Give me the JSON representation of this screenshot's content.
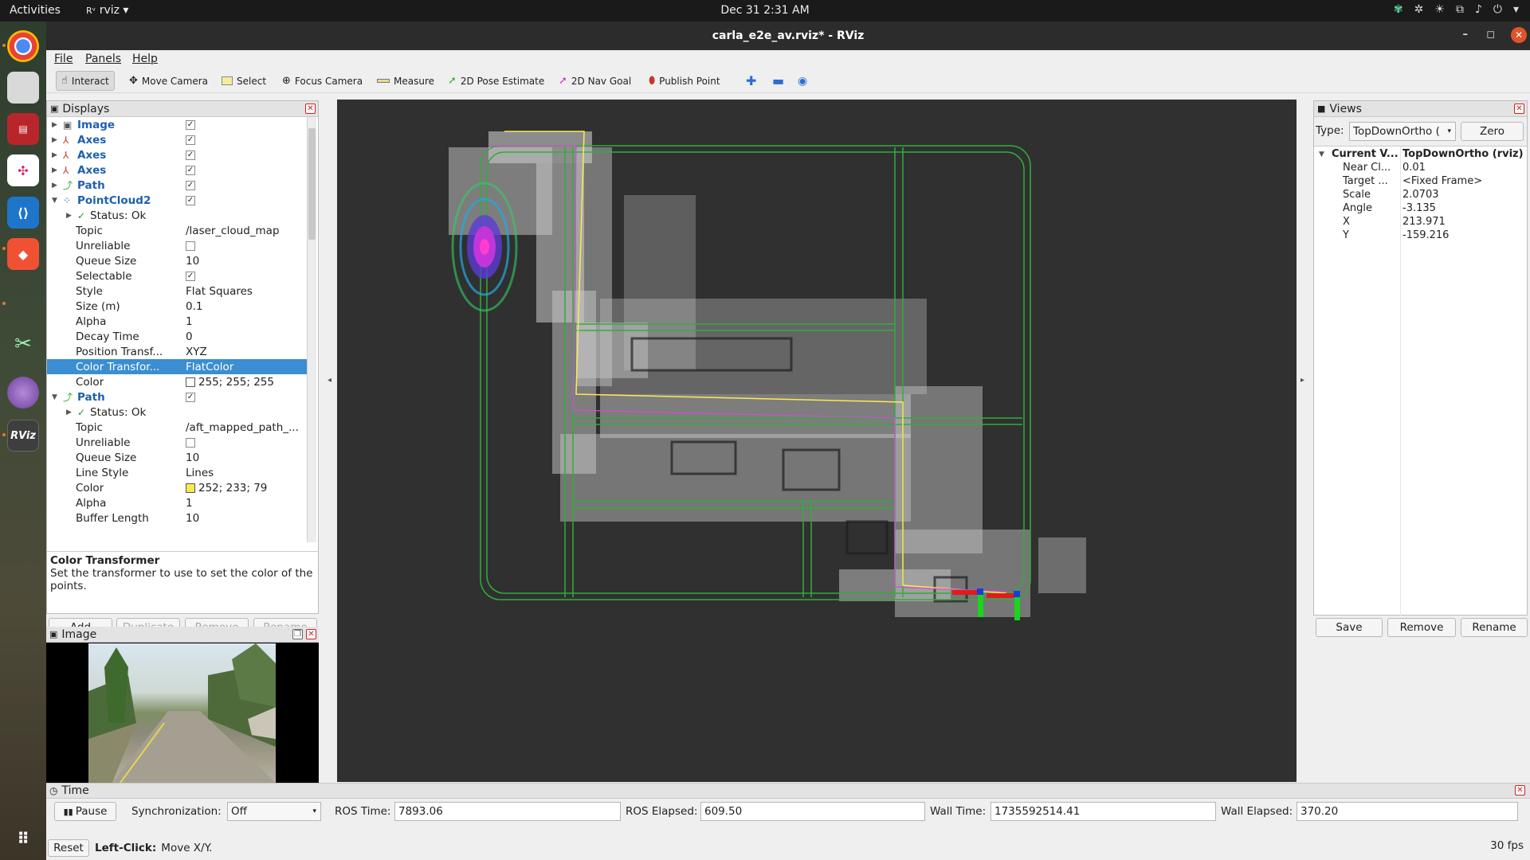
{
  "topbar": {
    "activities": "Activities",
    "app_name": "rviz",
    "app_icon": "Rᵛ",
    "clock": "Dec 31  2:31 AM",
    "tray_icons": [
      "network-icon",
      "settings-icon",
      "brightness-icon",
      "wired-network-icon",
      "volume-icon",
      "power-icon",
      "chevron-down-icon"
    ]
  },
  "dock": {
    "apps": [
      "chrome-icon",
      "files-icon",
      "terminal-icon",
      "slack-icon",
      "vscode-icon",
      "git-icon",
      "rqt-icon",
      "telescope-icon",
      "rviz-icon"
    ],
    "rviz_label": "RViz",
    "grid_icon": "show-apps-icon"
  },
  "window": {
    "title": "carla_e2e_av.rviz* - RViz",
    "minimize": "–",
    "maximize": "◻",
    "close": "✕"
  },
  "menu": {
    "file": "File",
    "panels": "Panels",
    "help": "Help"
  },
  "toolbar": {
    "interact": "Interact",
    "move_camera": "Move Camera",
    "select": "Select",
    "focus_camera": "Focus Camera",
    "measure": "Measure",
    "pose_estimate": "2D Pose Estimate",
    "nav_goal": "2D Nav Goal",
    "publish_point": "Publish Point"
  },
  "displays": {
    "title": "Displays",
    "rows": [
      {
        "name": "Image",
        "checked": true,
        "kind": "display",
        "icon": "image-icon"
      },
      {
        "name": "Axes",
        "checked": true,
        "kind": "display",
        "icon": "axes-icon"
      },
      {
        "name": "Axes",
        "checked": true,
        "kind": "display",
        "icon": "axes-icon"
      },
      {
        "name": "Axes",
        "checked": true,
        "kind": "display",
        "icon": "axes-icon"
      },
      {
        "name": "Path",
        "checked": true,
        "kind": "display",
        "icon": "path-icon"
      },
      {
        "name": "PointCloud2",
        "checked": true,
        "kind": "display",
        "icon": "pointcloud-icon",
        "expanded": true
      },
      {
        "name": "Status: Ok",
        "kind": "status"
      },
      {
        "name": "Topic",
        "value": "/laser_cloud_map"
      },
      {
        "name": "Unreliable",
        "checkbox": false
      },
      {
        "name": "Queue Size",
        "value": "10"
      },
      {
        "name": "Selectable",
        "checkbox": true
      },
      {
        "name": "Style",
        "value": "Flat Squares"
      },
      {
        "name": "Size (m)",
        "value": "0.1"
      },
      {
        "name": "Alpha",
        "value": "1"
      },
      {
        "name": "Decay Time",
        "value": "0"
      },
      {
        "name": "Position Transf...",
        "value": "XYZ"
      },
      {
        "name": "Color Transfor...",
        "value": "FlatColor",
        "selected": true
      },
      {
        "name": "Color",
        "value": "255; 255; 255",
        "swatch": "#ffffff"
      },
      {
        "name": "Path",
        "checked": true,
        "kind": "display",
        "icon": "path-icon",
        "expanded": true
      },
      {
        "name": "Status: Ok",
        "kind": "status"
      },
      {
        "name": "Topic",
        "value": "/aft_mapped_path_..."
      },
      {
        "name": "Unreliable",
        "checkbox": false
      },
      {
        "name": "Queue Size",
        "value": "10"
      },
      {
        "name": "Line Style",
        "value": "Lines"
      },
      {
        "name": "Color",
        "value": "252; 233; 79",
        "swatch": "#fce94f"
      },
      {
        "name": "Alpha",
        "value": "1"
      },
      {
        "name": "Buffer Length",
        "value": "10"
      }
    ],
    "help_title": "Color Transformer",
    "help_text": "Set the transformer to use to set the color of the points.",
    "add": "Add",
    "duplicate": "Duplicate",
    "remove": "Remove",
    "rename": "Rename"
  },
  "image_panel": {
    "title": "Image"
  },
  "views": {
    "title": "Views",
    "type_label": "Type:",
    "type_value": "TopDownOrtho (",
    "zero": "Zero",
    "current_label": "Current V...",
    "current_value": "TopDownOrtho (rviz)",
    "props": [
      {
        "name": "Near Cl...",
        "value": "0.01"
      },
      {
        "name": "Target ...",
        "value": "<Fixed Frame>"
      },
      {
        "name": "Scale",
        "value": "2.0703"
      },
      {
        "name": "Angle",
        "value": "-3.135"
      },
      {
        "name": "X",
        "value": "213.971"
      },
      {
        "name": "Y",
        "value": "-159.216"
      }
    ],
    "save": "Save",
    "remove": "Remove",
    "rename": "Rename"
  },
  "time": {
    "title": "Time",
    "pause": "Pause",
    "sync_label": "Synchronization:",
    "sync_value": "Off",
    "ros_time_label": "ROS Time:",
    "ros_time": "7893.06",
    "ros_elapsed_label": "ROS Elapsed:",
    "ros_elapsed": "609.50",
    "wall_time_label": "Wall Time:",
    "wall_time": "1735592514.41",
    "wall_elapsed_label": "Wall Elapsed:",
    "wall_elapsed": "370.20"
  },
  "status": {
    "reset": "Reset",
    "hint_bold": "Left-Click:",
    "hint": " Move X/Y.",
    "fps": "30 fps"
  },
  "colors": {
    "selection": "#3a8ed1",
    "display_name": "#1f5fae",
    "grid_green": "#2fae3a",
    "path_yellow": "#fce94f",
    "magenta_path": "#d14fd1"
  }
}
